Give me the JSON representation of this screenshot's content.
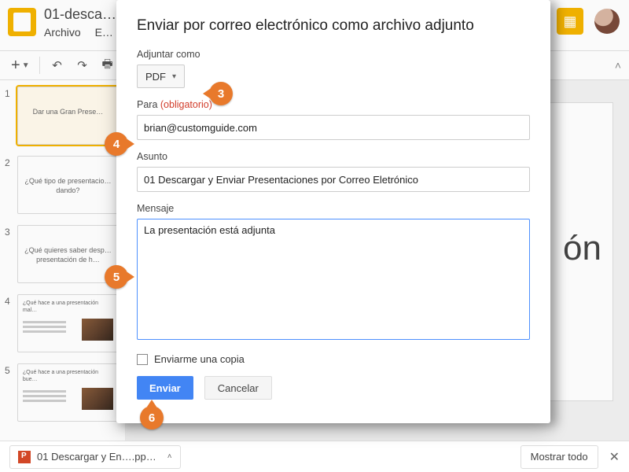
{
  "header": {
    "doc_title": "01-desca…",
    "menus": {
      "file": "Archivo",
      "edit": "E…"
    }
  },
  "toolbar": {
    "add_symbol": "+"
  },
  "thumbnails": [
    {
      "num": "1",
      "selected": true,
      "text": "Dar una Gran Prese…"
    },
    {
      "num": "2",
      "selected": false,
      "text": "¿Qué tipo de presentacio… dando?"
    },
    {
      "num": "3",
      "selected": false,
      "text": "¿Qué quieres saber desp… presentación de h…"
    },
    {
      "num": "4",
      "selected": false,
      "text": "¿Qué hace a una presentación mal…"
    },
    {
      "num": "5",
      "selected": false,
      "text": "¿Qué hace a una presentación bue…"
    }
  ],
  "canvas": {
    "cutoff_text": "ón"
  },
  "modal": {
    "title": "Enviar por correo electrónico como archivo adjunto",
    "attach_label": "Adjuntar como",
    "attach_value": "PDF",
    "to_label": "Para",
    "required": "(obligatorio)",
    "to_value": "brian@customguide.com",
    "subject_label": "Asunto",
    "subject_value": "01 Descargar y Enviar Presentaciones por Correo Eletrónico",
    "message_label": "Mensaje",
    "message_value": "La presentación está adjunta",
    "copy_me_label": "Enviarme una copia",
    "send_label": "Enviar",
    "cancel_label": "Cancelar"
  },
  "download_bar": {
    "file": "01 Descargar y En….pp…",
    "show_all": "Mostrar todo"
  },
  "callouts": {
    "c3": "3",
    "c4": "4",
    "c5": "5",
    "c6": "6"
  }
}
